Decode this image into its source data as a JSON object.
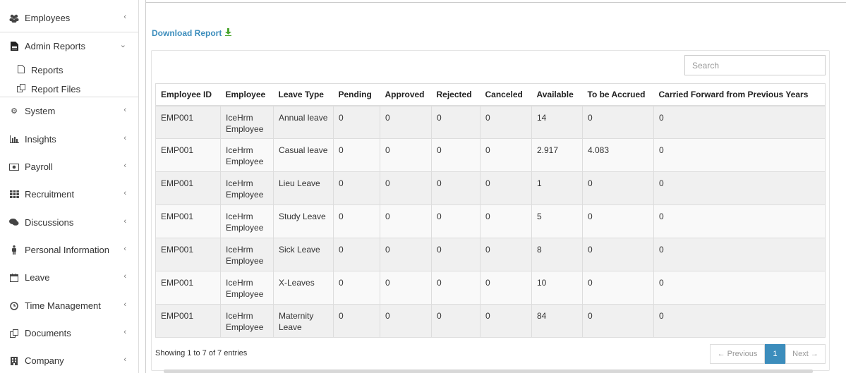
{
  "sidebar": {
    "employees": "Employees",
    "admin_reports": "Admin Reports",
    "sub_reports": "Reports",
    "sub_report_files": "Report Files",
    "system": "System",
    "insights": "Insights",
    "payroll": "Payroll",
    "recruitment": "Recruitment",
    "discussions": "Discussions",
    "personal_information": "Personal Information",
    "leave": "Leave",
    "time_management": "Time Management",
    "documents": "Documents",
    "company": "Company"
  },
  "main": {
    "download_report": "Download Report",
    "search_placeholder": "Search",
    "columns": [
      "Employee ID",
      "Employee",
      "Leave Type",
      "Pending",
      "Approved",
      "Rejected",
      "Canceled",
      "Available",
      "To be Accrued",
      "Carried Forward from Previous Years"
    ],
    "rows": [
      [
        "EMP001",
        "IceHrm Employee",
        "Annual leave",
        "0",
        "0",
        "0",
        "0",
        "14",
        "0",
        "0"
      ],
      [
        "EMP001",
        "IceHrm Employee",
        "Casual leave",
        "0",
        "0",
        "0",
        "0",
        "2.917",
        "4.083",
        "0"
      ],
      [
        "EMP001",
        "IceHrm Employee",
        "Lieu Leave",
        "0",
        "0",
        "0",
        "0",
        "1",
        "0",
        "0"
      ],
      [
        "EMP001",
        "IceHrm Employee",
        "Study Leave",
        "0",
        "0",
        "0",
        "0",
        "5",
        "0",
        "0"
      ],
      [
        "EMP001",
        "IceHrm Employee",
        "Sick Leave",
        "0",
        "0",
        "0",
        "0",
        "8",
        "0",
        "0"
      ],
      [
        "EMP001",
        "IceHrm Employee",
        "X-Leaves",
        "0",
        "0",
        "0",
        "0",
        "10",
        "0",
        "0"
      ],
      [
        "EMP001",
        "IceHrm Employee",
        "Maternity Leave",
        "0",
        "0",
        "0",
        "0",
        "84",
        "0",
        "0"
      ]
    ],
    "showing": "Showing 1 to 7 of 7 entries",
    "pager": {
      "previous": "← Previous",
      "current": "1",
      "next": "Next →"
    }
  }
}
